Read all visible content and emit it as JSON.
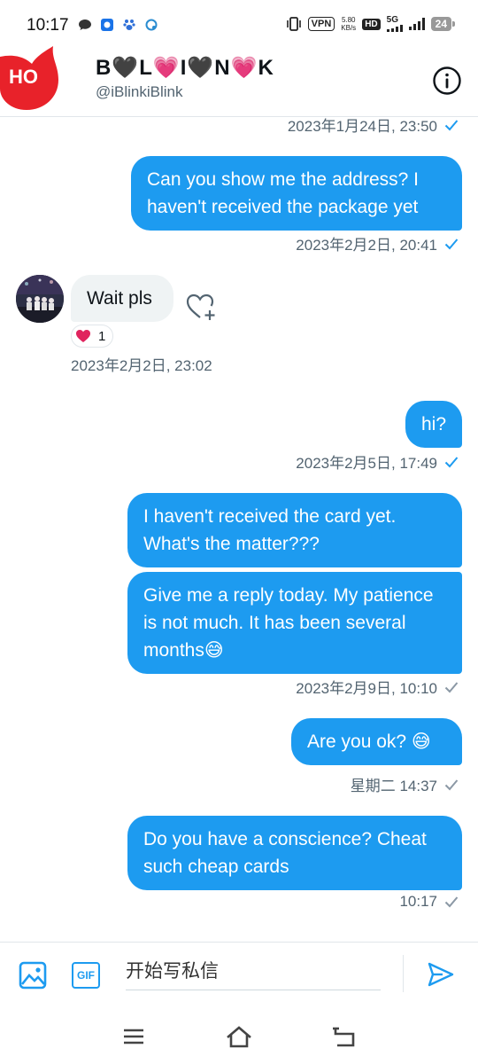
{
  "status_bar": {
    "time": "10:17",
    "vpn": "VPN",
    "speed_value": "5.80",
    "speed_unit": "KB/s",
    "hd": "HD",
    "network": "5G",
    "battery": "24"
  },
  "header": {
    "badge_text": "HO",
    "name": "B🖤L💗I🖤N💗K",
    "handle": "@iBlinkiBlink",
    "info_icon": "info-icon"
  },
  "conversation": {
    "ts_top": "2023年1月24日, 23:50",
    "msg1": "Can you show me the address? I haven't received the package yet",
    "ts1": "2023年2月2日, 20:41",
    "recv_msg": "Wait pls",
    "reaction_count": "1",
    "ts_recv": "2023年2月2日, 23:02",
    "msg2": "hi?",
    "ts2": "2023年2月5日, 17:49",
    "msg3": "I haven't received the card yet. What's the matter???",
    "msg4": "Give me a reply today. My patience is not much. It has been several months😅",
    "ts3": "2023年2月9日, 10:10",
    "msg5": "Are you ok?  😅",
    "ts4": "星期二 14:37",
    "msg6": "Do you have a conscience? Cheat such cheap cards",
    "ts5": "10:17"
  },
  "composer": {
    "placeholder": "开始写私信",
    "gif_label": "GIF"
  },
  "colors": {
    "accent": "#1d9bf0",
    "received_bubble": "#eff3f4",
    "badge_red": "#e8222a"
  }
}
